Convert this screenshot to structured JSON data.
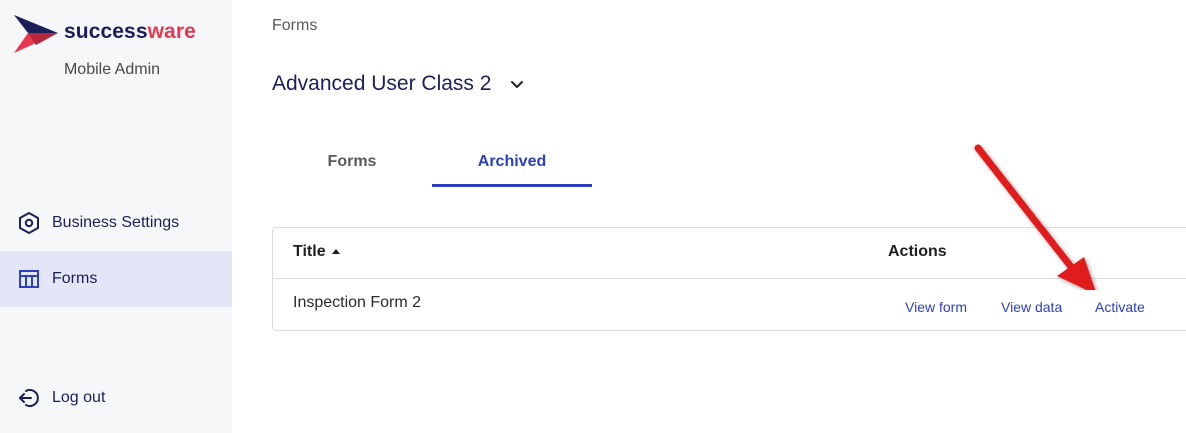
{
  "brand": {
    "name_part1": "success",
    "name_part2": "ware",
    "app_name": "Mobile Admin"
  },
  "sidebar": {
    "items": [
      {
        "label": "Business Settings",
        "icon": "hexagon-settings-icon"
      },
      {
        "label": "Forms",
        "icon": "table-icon",
        "active": true
      },
      {
        "label": "Log out",
        "icon": "logout-icon"
      }
    ]
  },
  "breadcrumb": "Forms",
  "page": {
    "title": "Advanced User Class 2"
  },
  "tabs": [
    {
      "label": "Forms",
      "active": false
    },
    {
      "label": "Archived",
      "active": true
    }
  ],
  "table": {
    "columns": {
      "title": "Title",
      "actions": "Actions"
    },
    "sort": "ascending",
    "rows": [
      {
        "title": "Inspection Form 2",
        "actions": [
          "View form",
          "View data",
          "Activate"
        ]
      }
    ]
  },
  "colors": {
    "accent": "#2b3fbf",
    "brand_dark": "#1a1f5c",
    "brand_red": "#e8384f",
    "annotation_arrow": "#e11b1b"
  }
}
